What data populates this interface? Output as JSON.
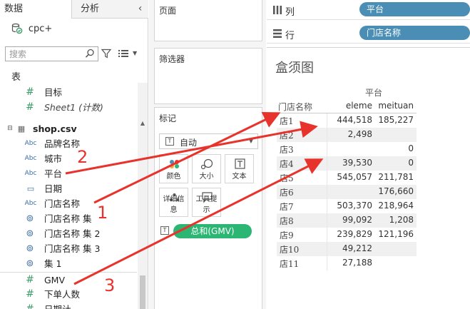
{
  "left_pane": {
    "tab_data": "数据",
    "tab_analysis": "分析",
    "collapse_glyph": "‹",
    "datasource": "cpc+",
    "search_placeholder": "搜索",
    "tables_header": "表",
    "fields": [
      {
        "name": "目标",
        "type": "measure"
      },
      {
        "name": "Sheet1 (计数)",
        "type": "measure",
        "italic": true
      },
      {
        "name": "shop.csv",
        "type": "table",
        "bold": true
      },
      {
        "name": "品牌名称",
        "type": "string"
      },
      {
        "name": "城市",
        "type": "string"
      },
      {
        "name": "平台",
        "type": "string"
      },
      {
        "name": "日期",
        "type": "date"
      },
      {
        "name": "门店名称",
        "type": "string"
      },
      {
        "name": "门店名称 集",
        "type": "set"
      },
      {
        "name": "门店名称 集 2",
        "type": "set"
      },
      {
        "name": "门店名称 集 3",
        "type": "set"
      },
      {
        "name": "集 1",
        "type": "set"
      },
      {
        "name": "GMV",
        "type": "measure"
      },
      {
        "name": "下单人数",
        "type": "measure"
      },
      {
        "name": "日期计",
        "type": "measure"
      }
    ]
  },
  "cards": {
    "pages_title": "页面",
    "filters_title": "筛选器",
    "marks_title": "标记",
    "mark_type": "自动",
    "mark_buttons": {
      "color": "颜色",
      "size": "大小",
      "label": "文本",
      "detail": "详细信息",
      "tooltip": "工具提示"
    },
    "measure_pill": "总和(GMV)"
  },
  "shelves": {
    "columns_label": "列",
    "columns_pill": "平台",
    "rows_label": "行",
    "rows_pill": "门店名称"
  },
  "viz": {
    "title": "盒须图",
    "column_dimension": "平台",
    "row_header": "门店名称",
    "column_headers": [
      "eleme",
      "meituan"
    ],
    "rows": [
      {
        "store": "店1",
        "eleme": "444,518",
        "meituan": "185,227"
      },
      {
        "store": "店2",
        "eleme": "2,498",
        "meituan": ""
      },
      {
        "store": "店3",
        "eleme": "",
        "meituan": "0"
      },
      {
        "store": "店4",
        "eleme": "39,530",
        "meituan": "0"
      },
      {
        "store": "店5",
        "eleme": "545,057",
        "meituan": "211,781"
      },
      {
        "store": "店6",
        "eleme": "",
        "meituan": "176,660"
      },
      {
        "store": "店7",
        "eleme": "503,370",
        "meituan": "218,964"
      },
      {
        "store": "店8",
        "eleme": "99,092",
        "meituan": "1,208"
      },
      {
        "store": "店9",
        "eleme": "239,829",
        "meituan": "121,196"
      },
      {
        "store": "店10",
        "eleme": "49,212",
        "meituan": ""
      },
      {
        "store": "店11",
        "eleme": "27,188",
        "meituan": ""
      }
    ]
  },
  "annotations": {
    "labels": [
      "1",
      "2",
      "3"
    ],
    "color": "#e8322c"
  },
  "colors": {
    "measure_pill": "#2bb673",
    "dimension_pill": "#4a8db5",
    "annotation": "#e8322c"
  }
}
